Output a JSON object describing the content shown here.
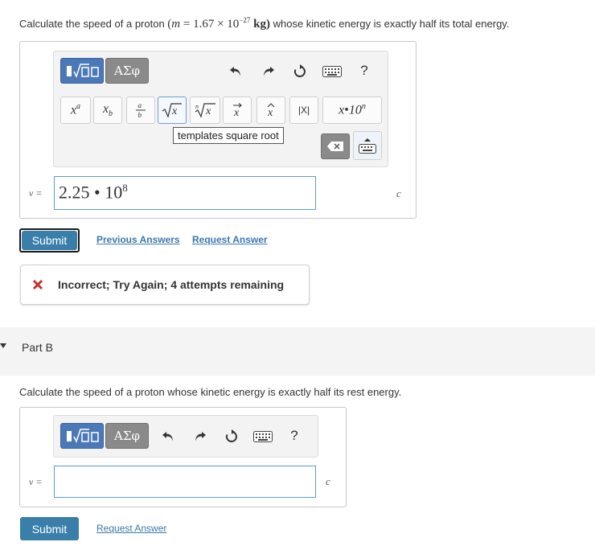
{
  "partA": {
    "question_prefix": "Calculate the speed of a proton ",
    "question_math_open": "(",
    "question_math_var": "m",
    "question_math_rest": " = 1.67 × 10",
    "question_math_exp": "−27",
    "question_math_unit": " kg)",
    "question_suffix": " whose kinetic energy is exactly half its total energy.",
    "toolbar": {
      "greek_label": "ΑΣφ",
      "help_label": "?",
      "templates": [
        "x^a",
        "x_b",
        "a/b",
        "√x",
        "ⁿ√x",
        "x⃗",
        "x̂",
        "|X|",
        "x·10ⁿ"
      ],
      "tooltip": "templates square root"
    },
    "var_label": "v =",
    "answer_base": "2.25 • 10",
    "answer_exp": "8",
    "unit": "c",
    "submit_label": "Submit",
    "previous_answers_label": "Previous Answers",
    "request_answer_label": "Request Answer",
    "feedback_text": "Incorrect; Try Again; 4 attempts remaining"
  },
  "partB": {
    "title": "Part B",
    "question": "Calculate the speed of a proton whose kinetic energy is exactly half its rest energy.",
    "toolbar": {
      "greek_label": "ΑΣφ",
      "help_label": "?"
    },
    "var_label": "v =",
    "answer_value": "",
    "unit": "c",
    "submit_label": "Submit",
    "request_answer_label": "Request Answer"
  },
  "colors": {
    "accent": "#3a7eaa",
    "link": "#3b78b0",
    "error": "#c9302c",
    "input_border": "#5a9bd5"
  },
  "icons": [
    "templates-icon",
    "greek-icon",
    "undo-icon",
    "redo-icon",
    "reset-icon",
    "keyboard-icon",
    "help-icon",
    "backspace-icon",
    "keyboard-toggle-icon",
    "incorrect-icon",
    "expand-triangle-icon"
  ]
}
